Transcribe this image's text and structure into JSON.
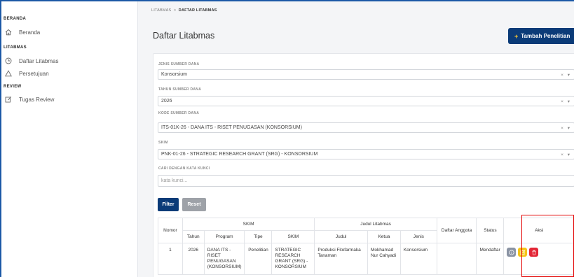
{
  "sidebar": {
    "sections": [
      {
        "title": "BERANDA",
        "items": [
          {
            "label": "Beranda",
            "icon": "home-icon"
          }
        ]
      },
      {
        "title": "LITABMAS",
        "items": [
          {
            "label": "Daftar Litabmas",
            "icon": "clock-icon"
          },
          {
            "label": "Persetujuan",
            "icon": "triangle-icon"
          }
        ]
      },
      {
        "title": "REVIEW",
        "items": [
          {
            "label": "Tugas Review",
            "icon": "edit-icon"
          }
        ]
      }
    ]
  },
  "breadcrumb": {
    "parent": "LITABMAS",
    "sep": ">",
    "current": "DAFTAR LITABMAS"
  },
  "header": {
    "title": "Daftar Litabmas",
    "add_button": "Tambah Penelitian",
    "add_icon": "+"
  },
  "filters": {
    "sumber_dana": {
      "label": "JENIS SUMBER DANA",
      "value": "Konsorsium"
    },
    "tahun": {
      "label": "TAHUN SUMBER DANA",
      "value": "2026"
    },
    "kode": {
      "label": "KODE SUMBER DANA",
      "value": "ITS-01K-26 - DANA ITS - RISET PENUGASAN (KONSORSIUM)"
    },
    "skim": {
      "label": "SKIM",
      "value": "PNK-01-26 - STRATEGIC RESEARCH GRANT (SRG) - KONSORSIUM"
    },
    "search": {
      "label": "CARI DENGAN KATA KUNCI",
      "placeholder": "kata kunci..."
    },
    "filter_button": "Filter",
    "reset_button": "Reset",
    "clear_icon": "×",
    "dropdown_icon": "▾"
  },
  "table": {
    "headers": {
      "nomor": "Nomor",
      "skim_group": "SKIM",
      "judul_group": "Judul Litabmas",
      "daftar_anggota": "Daftar Anggota",
      "status": "Status",
      "aksi": "Aksi",
      "tahun": "Tahun",
      "program": "Program",
      "tipe": "Tipe",
      "skim": "SKIM",
      "judul": "Judul",
      "ketua": "Ketua",
      "jenis": "Jenis"
    },
    "rows": [
      {
        "nomor": "1",
        "tahun": "2026",
        "program": "DANA ITS - RISET PENUGASAN (KONSORSIUM)",
        "tipe": "Penelitian",
        "skim": "STRATEGIC RESEARCH GRANT (SRG) - KONSORSIUM",
        "judul": "Produksi Fitofarmaka Tanaman",
        "ketua": "Mokhamad Nur Cahyadi",
        "jenis": "Konsorsium",
        "anggota": "",
        "status": "Mendaftar"
      }
    ]
  },
  "colors": {
    "primary": "#0b3b78",
    "accent": "#ffcc33",
    "highlight": "#e30000",
    "info": "#8a93a3",
    "warning": "#f5c518",
    "danger": "#e32636"
  }
}
